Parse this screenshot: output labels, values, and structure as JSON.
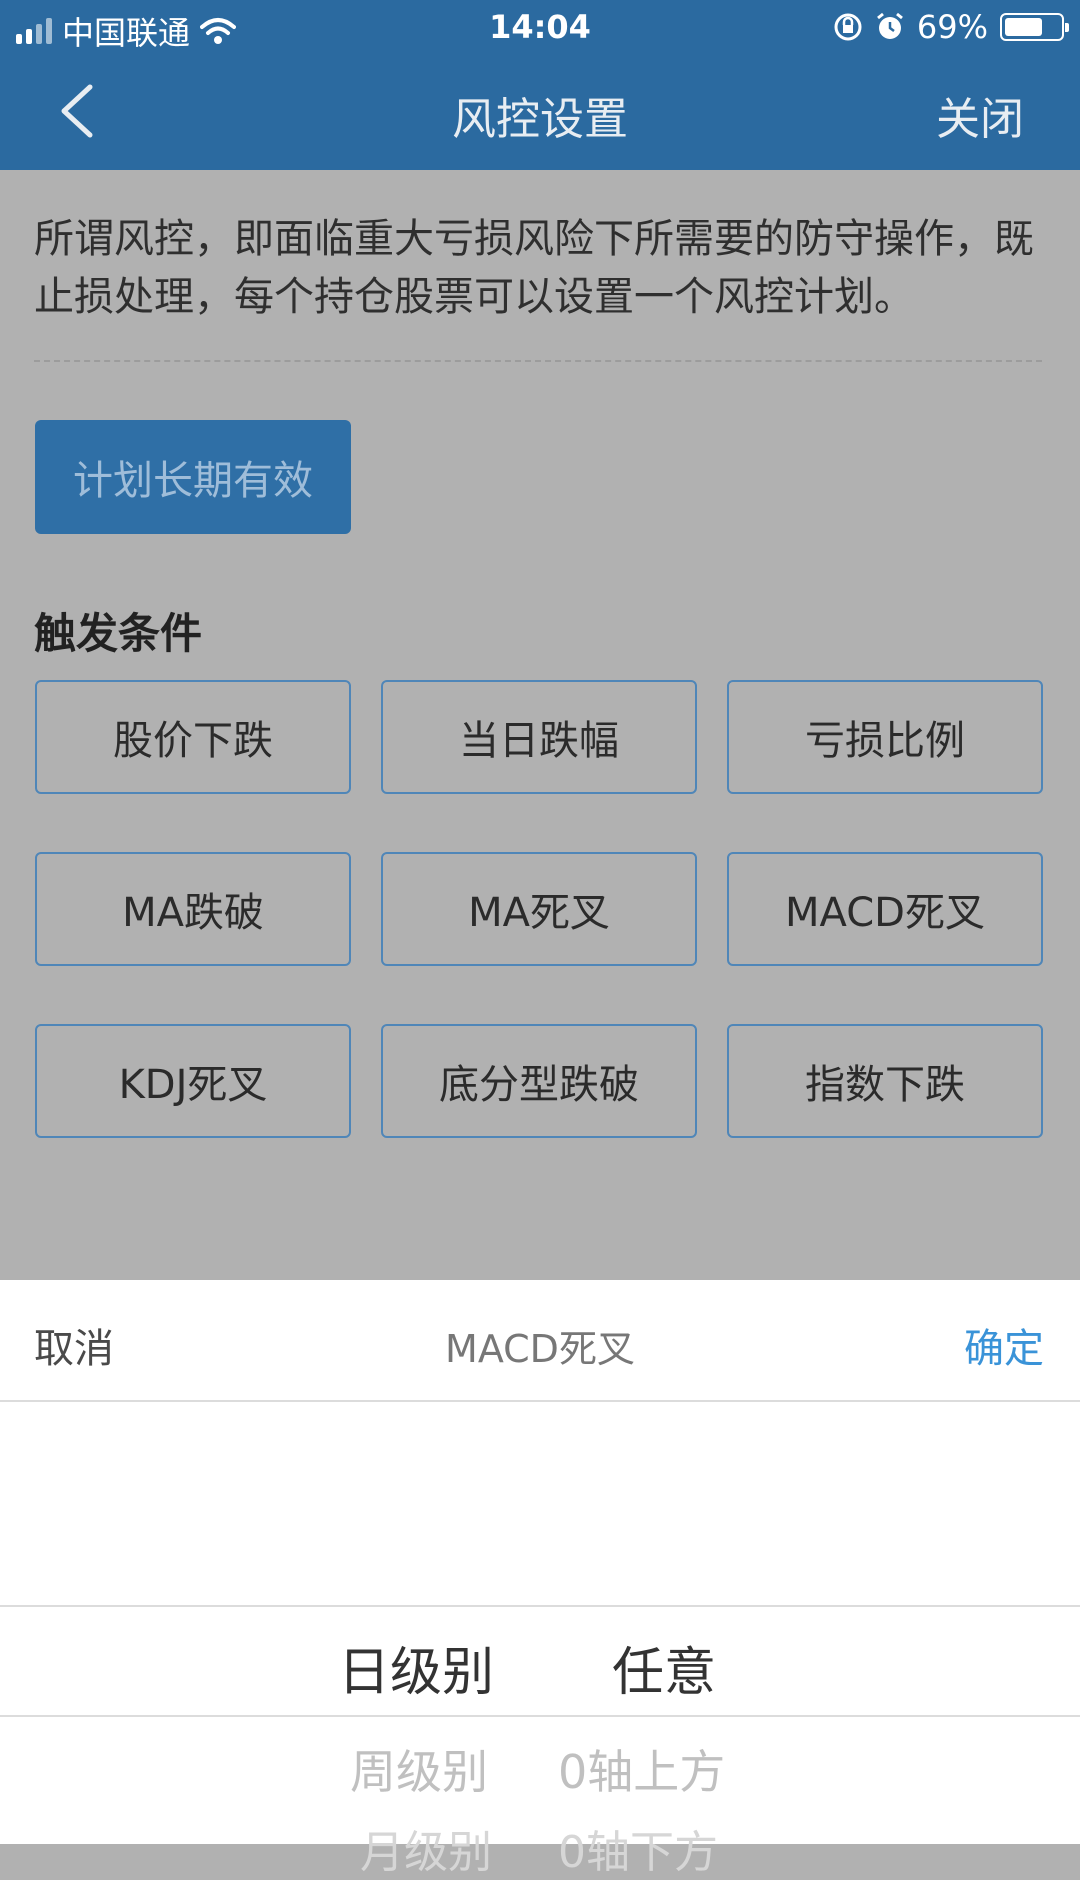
{
  "status_bar": {
    "carrier": "中国联通",
    "time": "14:04",
    "battery": "69%",
    "battery_level": 0.69
  },
  "nav": {
    "title": "风控设置",
    "close_label": "关闭"
  },
  "description": "所谓风控，即面临重大亏损风险下所需要的防守操作，既止损处理，每个持仓股票可以设置一个风控计划。",
  "plan_button": "计划长期有效",
  "section_title": "触发条件",
  "conditions": [
    "股价下跌",
    "当日跌幅",
    "亏损比例",
    "MA跌破",
    "MA死叉",
    "MACD死叉",
    "KDJ死叉",
    "底分型跌破",
    "指数下跌"
  ],
  "picker": {
    "cancel": "取消",
    "title": "MACD死叉",
    "confirm": "确定",
    "col1": {
      "selected": "日级别",
      "below": [
        "周级别",
        "月级别"
      ]
    },
    "col2": {
      "selected": "任意",
      "below": [
        "0轴上方",
        "0轴下方"
      ]
    }
  },
  "icons": {
    "back": "chevron-left-icon",
    "wifi": "wifi-icon",
    "lock": "rotation-lock-icon",
    "alarm": "alarm-icon",
    "battery": "battery-icon",
    "signal": "signal-icon"
  },
  "colors": {
    "header": "#2b6aa0",
    "accent": "#3a93d8",
    "button": "#2f6fa6"
  }
}
